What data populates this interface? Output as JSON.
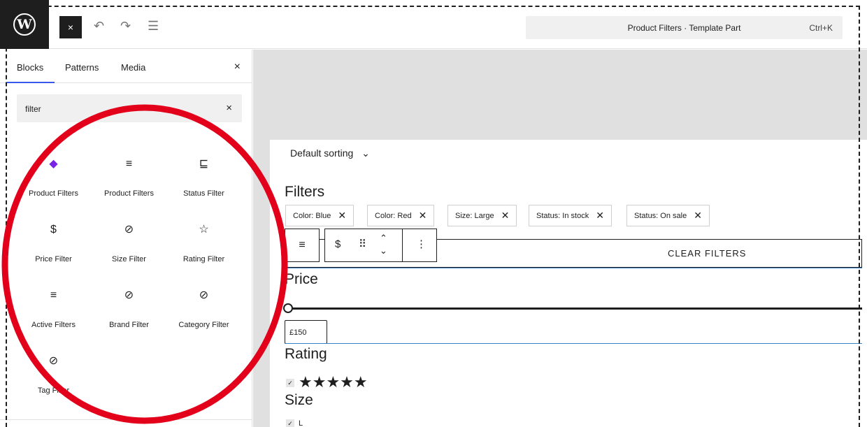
{
  "topbar": {
    "logo_letter": "W",
    "close_glyph": "×",
    "undo_glyph": "↶",
    "redo_glyph": "↷",
    "outline_glyph": "☰",
    "command_title": "Product Filters · Template Part",
    "command_shortcut": "Ctrl+K"
  },
  "sidebar": {
    "tabs": [
      "Blocks",
      "Patterns",
      "Media"
    ],
    "active_tab": "Blocks",
    "close_glyph": "×",
    "search_value": "filter",
    "search_clear_glyph": "×",
    "blocks": [
      {
        "label": "Product Filters",
        "icon": "diamond-icon",
        "glyph": "◆"
      },
      {
        "label": "Product Filters",
        "icon": "filter-icon",
        "glyph": "≡"
      },
      {
        "label": "Status Filter",
        "icon": "status-filter-icon",
        "glyph": "⊑"
      },
      {
        "label": "Price Filter",
        "icon": "price-filter-icon",
        "glyph": "$"
      },
      {
        "label": "Size Filter",
        "icon": "size-filter-icon",
        "glyph": "⊘"
      },
      {
        "label": "Rating Filter",
        "icon": "rating-filter-icon",
        "glyph": "☆"
      },
      {
        "label": "Active Filters",
        "icon": "active-filters-icon",
        "glyph": "≡"
      },
      {
        "label": "Brand Filter",
        "icon": "brand-filter-icon",
        "glyph": "⊘"
      },
      {
        "label": "Category Filter",
        "icon": "category-filter-icon",
        "glyph": "⊘"
      },
      {
        "label": "Tag Filter",
        "icon": "tag-filter-icon",
        "glyph": "⊘"
      }
    ]
  },
  "canvas": {
    "sorting_label": "Default sorting",
    "sorting_chevron": "⌄",
    "filters_heading": "Filters",
    "chips": [
      {
        "label": "Color: Blue"
      },
      {
        "label": "Color: Red"
      },
      {
        "label": "Size: Large"
      },
      {
        "label": "Status: In stock"
      },
      {
        "label": "Status: On sale"
      }
    ],
    "chip_remove_glyph": "✕",
    "clear_filters_label": "CLEAR FILTERS",
    "price_heading": "Price",
    "price_value": "£150",
    "rating_heading": "Rating",
    "rating_stars": "★★★★★",
    "size_heading": "Size",
    "size_first_option": "L",
    "check_glyph": "✓"
  },
  "colors": {
    "accent": "#3858e9",
    "block_purple": "#7a22e6",
    "annotation_red": "#e3001b",
    "selection_blue": "#3582c4"
  }
}
